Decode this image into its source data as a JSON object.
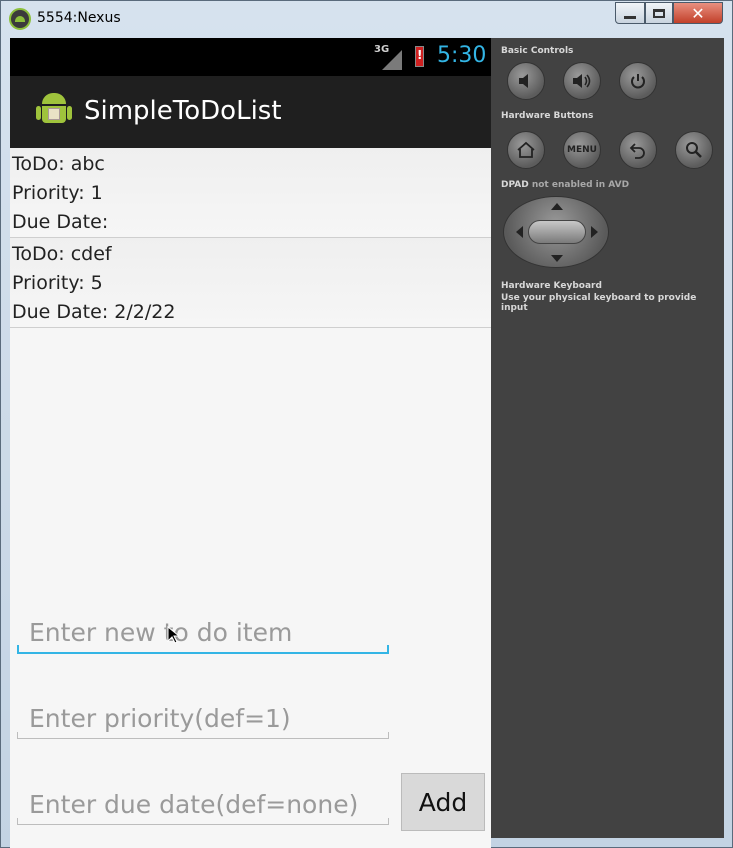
{
  "window": {
    "title": "5554:Nexus",
    "close_glyph": "✕"
  },
  "statusbar": {
    "network": "3G",
    "time": "5:30"
  },
  "app": {
    "title": "SimpleToDoList"
  },
  "todos": [
    {
      "todo": "ToDo: abc",
      "priority": "Priority: 1",
      "due": "Due Date:"
    },
    {
      "todo": "ToDo: cdef",
      "priority": "Priority: 5",
      "due": "Due Date: 2/2/22"
    }
  ],
  "form": {
    "item_placeholder": "Enter new to do item",
    "priority_placeholder": "Enter priority(def=1)",
    "due_placeholder": "Enter due date(def=none)",
    "add_label": "Add"
  },
  "panel": {
    "basic_controls": "Basic Controls",
    "hardware_buttons": "Hardware Buttons",
    "menu_label": "MENU",
    "dpad": "DPAD",
    "dpad_note": "not enabled in AVD",
    "keyboard": "Hardware Keyboard",
    "keyboard_note": "Use your physical keyboard to provide input"
  },
  "colors": {
    "accent": "#33b5e5",
    "panel_bg": "#424242",
    "actionbar_bg": "#1f1f1f"
  }
}
